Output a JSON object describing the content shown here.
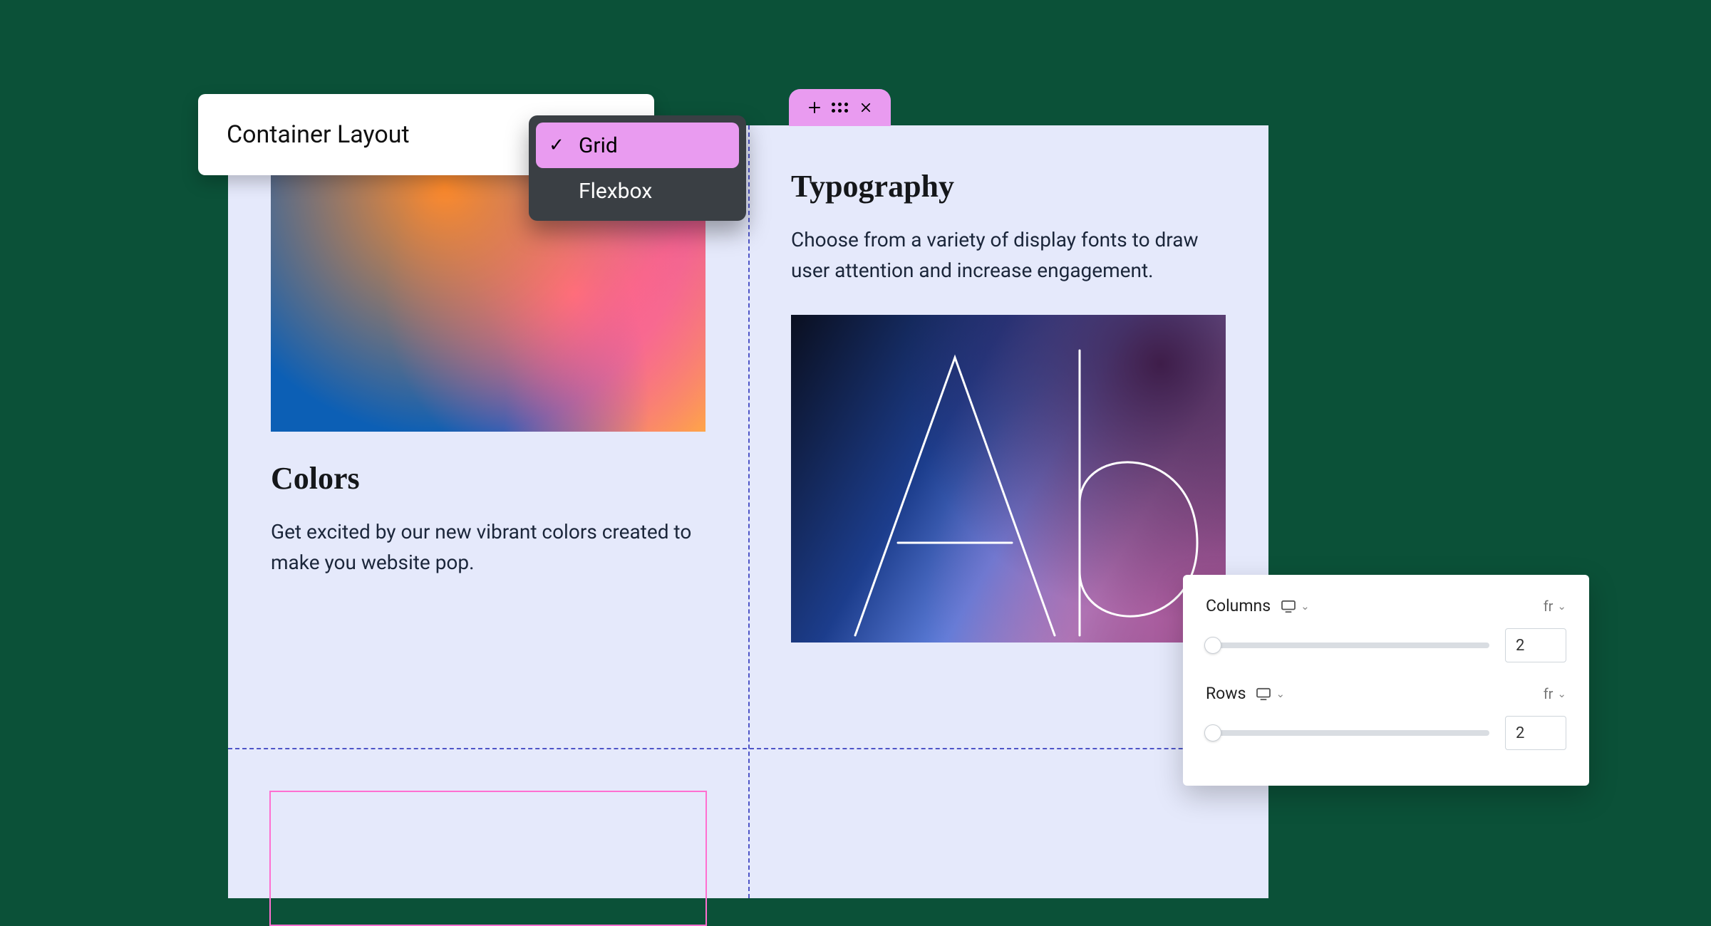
{
  "layoutPanel": {
    "label": "Container Layout",
    "options": [
      "Grid",
      "Flexbox"
    ],
    "selected": "Grid"
  },
  "tab": {
    "addIcon": "plus-icon",
    "dragIcon": "drag-handle-icon",
    "closeIcon": "close-icon"
  },
  "cells": {
    "colors": {
      "heading": "Colors",
      "body": "Get excited by our new vibrant colors created to make you website pop."
    },
    "typography": {
      "heading": "Typography",
      "body": "Choose from a variety of display fonts to draw user attention and increase engagement.",
      "sample": "Ab"
    }
  },
  "gridPanel": {
    "columns": {
      "label": "Columns",
      "unit": "fr",
      "value": "2"
    },
    "rows": {
      "label": "Rows",
      "unit": "fr",
      "value": "2"
    }
  }
}
